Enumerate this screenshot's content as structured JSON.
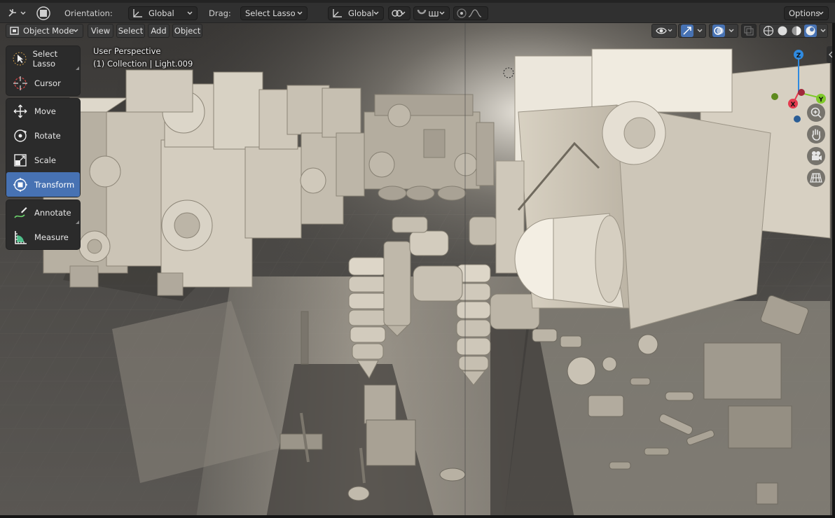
{
  "top_header": {
    "orientation_label": "Orientation:",
    "orientation_value": "Global",
    "drag_label": "Drag:",
    "drag_value": "Select Lasso",
    "transform_pivot_value": "Global",
    "options_label": "Options"
  },
  "viewport_header": {
    "mode": "Object Mode",
    "menus": [
      "View",
      "Select",
      "Add",
      "Object"
    ]
  },
  "viewport_info": {
    "view_name": "User Perspective",
    "collection_line": "(1) Collection | Light.009"
  },
  "toolbar": {
    "groups": [
      [
        {
          "label": "Select Lasso",
          "icon": "select-lasso-icon"
        },
        {
          "label": "Cursor",
          "icon": "cursor-icon"
        }
      ],
      [
        {
          "label": "Move",
          "icon": "move-icon"
        },
        {
          "label": "Rotate",
          "icon": "rotate-icon"
        },
        {
          "label": "Scale",
          "icon": "scale-icon"
        },
        {
          "label": "Transform",
          "icon": "transform-icon",
          "active": true
        }
      ],
      [
        {
          "label": "Annotate",
          "icon": "annotate-icon"
        },
        {
          "label": "Measure",
          "icon": "measure-icon"
        }
      ]
    ]
  },
  "gizmo": {
    "axes": [
      "Z",
      "Y",
      "X"
    ],
    "colors": {
      "x": "#e53b4f",
      "y": "#7fc92a",
      "z": "#2f8ae0"
    }
  },
  "nav_icons": [
    "zoom-icon",
    "hand-pan-icon",
    "camera-icon",
    "grid-view-icon"
  ],
  "colors": {
    "header_bg": "#303030",
    "active_tool": "#4772b3",
    "scene_floor": "#4a4a4a",
    "model_color": "#d9d2c5"
  }
}
